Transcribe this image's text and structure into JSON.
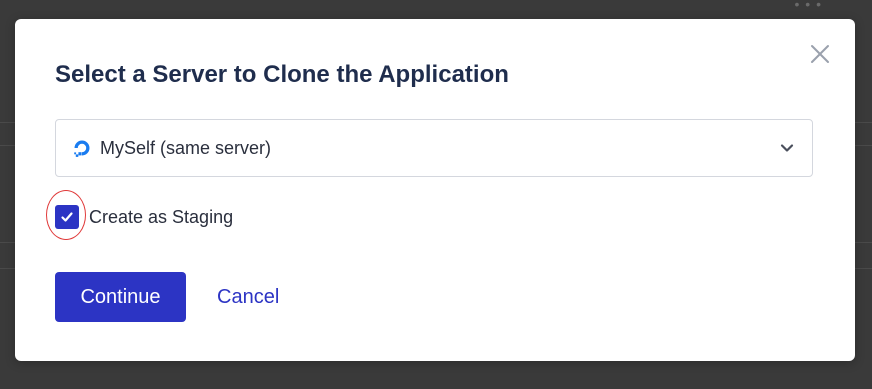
{
  "modal": {
    "title": "Select a Server to Clone the Application",
    "close_icon": "close-icon",
    "server_select": {
      "value": "MySelf (same server)",
      "provider_icon": "digitalocean-logo-icon",
      "dropdown_icon": "chevron-down-icon"
    },
    "staging_checkbox": {
      "label": "Create as Staging",
      "checked": true
    },
    "buttons": {
      "continue_label": "Continue",
      "cancel_label": "Cancel"
    }
  },
  "colors": {
    "primary": "#2c34c4",
    "title": "#1f2d4d",
    "overlay": "#3a3a3a",
    "annotation_ring": "#e03a3a"
  }
}
